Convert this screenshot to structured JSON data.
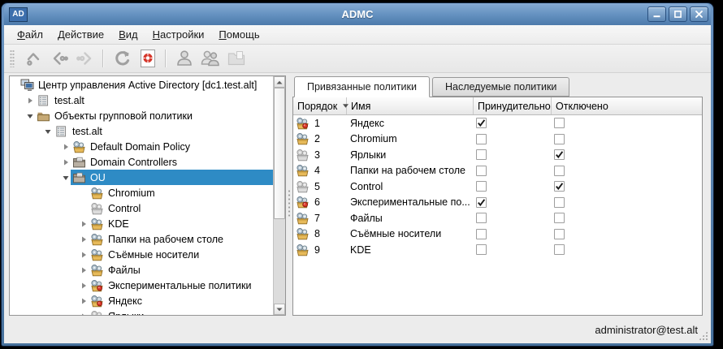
{
  "window": {
    "app_badge": "AD",
    "title": "ADMC",
    "controls": [
      {
        "name": "minimize",
        "icon": "minimize-icon"
      },
      {
        "name": "maximize",
        "icon": "maximize-icon"
      },
      {
        "name": "close",
        "icon": "close-icon"
      }
    ]
  },
  "menubar": {
    "items": [
      {
        "name": "file",
        "mnemonic": "Ф",
        "rest": "айл"
      },
      {
        "name": "action",
        "mnemonic": "Д",
        "rest": "ействие"
      },
      {
        "name": "view",
        "mnemonic": "В",
        "rest": "ид"
      },
      {
        "name": "settings",
        "mnemonic": "Н",
        "rest": "астройки"
      },
      {
        "name": "help",
        "mnemonic": "П",
        "rest": "омощь"
      }
    ]
  },
  "toolbar": {
    "groups": [
      [
        {
          "name": "go-up",
          "icon": "arrow-up-icon",
          "enabled": true
        },
        {
          "name": "go-back",
          "icon": "arrow-back-icon",
          "enabled": true
        },
        {
          "name": "go-forward",
          "icon": "arrow-forward-icon",
          "enabled": false
        }
      ],
      [
        {
          "name": "refresh",
          "icon": "refresh-icon",
          "enabled": true
        },
        {
          "name": "target",
          "icon": "target-icon",
          "enabled": true
        }
      ],
      [
        {
          "name": "create-user",
          "icon": "user-icon",
          "enabled": true
        },
        {
          "name": "create-group",
          "icon": "users-icon",
          "enabled": true
        },
        {
          "name": "create-ou",
          "icon": "folder-new-icon",
          "enabled": false
        }
      ]
    ]
  },
  "tree": {
    "items": [
      {
        "indent": 0,
        "expander": null,
        "icon": "computer-icon",
        "label": "Центр управления Active Directory [dc1.test.alt]",
        "selected": false
      },
      {
        "indent": 1,
        "expander": "closed",
        "icon": "domain-icon",
        "label": "test.alt",
        "selected": false
      },
      {
        "indent": 1,
        "expander": "open",
        "icon": "folder-icon",
        "label": "Объекты групповой политики",
        "selected": false
      },
      {
        "indent": 2,
        "expander": "open",
        "icon": "domain-icon",
        "label": "test.alt",
        "selected": false
      },
      {
        "indent": 3,
        "expander": "closed",
        "icon": "gpo-icon",
        "label": "Default Domain Policy",
        "selected": false
      },
      {
        "indent": 3,
        "expander": "closed",
        "icon": "ou-icon",
        "label": "Domain Controllers",
        "selected": false
      },
      {
        "indent": 3,
        "expander": "open",
        "icon": "ou-icon",
        "label": "OU",
        "selected": true
      },
      {
        "indent": 4,
        "expander": null,
        "icon": "gpo-icon",
        "label": "Chromium",
        "selected": false
      },
      {
        "indent": 4,
        "expander": null,
        "icon": "gpo-gray-icon",
        "label": "Control",
        "selected": false
      },
      {
        "indent": 4,
        "expander": "closed",
        "icon": "gpo-icon",
        "label": "KDE",
        "selected": false
      },
      {
        "indent": 4,
        "expander": "closed",
        "icon": "gpo-icon",
        "label": "Папки на рабочем столе",
        "selected": false
      },
      {
        "indent": 4,
        "expander": "closed",
        "icon": "gpo-icon",
        "label": "Съёмные носители",
        "selected": false
      },
      {
        "indent": 4,
        "expander": "closed",
        "icon": "gpo-icon",
        "label": "Файлы",
        "selected": false
      },
      {
        "indent": 4,
        "expander": "closed",
        "icon": "gpo-red-icon",
        "label": "Экспериментальные политики",
        "selected": false
      },
      {
        "indent": 4,
        "expander": "closed",
        "icon": "gpo-red-icon",
        "label": "Яндекс",
        "selected": false
      },
      {
        "indent": 4,
        "expander": "closed",
        "icon": "gpo-gray-icon",
        "label": "Ярлыки",
        "selected": false
      }
    ]
  },
  "tabs": {
    "items": [
      {
        "name": "linked-policies",
        "label": "Привязанные политики",
        "active": true
      },
      {
        "name": "inherited-policies",
        "label": "Наследуемые политики",
        "active": false
      }
    ]
  },
  "table": {
    "columns": [
      {
        "label": "Порядок",
        "sort": "desc"
      },
      {
        "label": "Имя",
        "sort": null
      },
      {
        "label": "Принудительно",
        "sort": null
      },
      {
        "label": "Отключено",
        "sort": null
      }
    ],
    "rows": [
      {
        "order": "1",
        "name": "Яндекс",
        "icon": "gpo-red-icon",
        "enforced": true,
        "disabled": false
      },
      {
        "order": "2",
        "name": "Chromium",
        "icon": "gpo-icon",
        "enforced": false,
        "disabled": false
      },
      {
        "order": "3",
        "name": "Ярлыки",
        "icon": "gpo-gray-icon",
        "enforced": false,
        "disabled": true
      },
      {
        "order": "4",
        "name": "Папки на рабочем столе",
        "icon": "gpo-icon",
        "enforced": false,
        "disabled": false
      },
      {
        "order": "5",
        "name": "Control",
        "icon": "gpo-gray-icon",
        "enforced": false,
        "disabled": true
      },
      {
        "order": "6",
        "name": "Экспериментальные по...",
        "icon": "gpo-red-icon",
        "enforced": true,
        "disabled": false
      },
      {
        "order": "7",
        "name": "Файлы",
        "icon": "gpo-icon",
        "enforced": false,
        "disabled": false
      },
      {
        "order": "8",
        "name": "Съёмные носители",
        "icon": "gpo-icon",
        "enforced": false,
        "disabled": false
      },
      {
        "order": "9",
        "name": "KDE",
        "icon": "gpo-icon",
        "enforced": false,
        "disabled": false
      }
    ]
  },
  "statusbar": {
    "user": "administrator@test.alt"
  },
  "colors": {
    "selection": "#2e8bc5",
    "titlebar": "#6390bf",
    "window_frame": "#47719c"
  }
}
